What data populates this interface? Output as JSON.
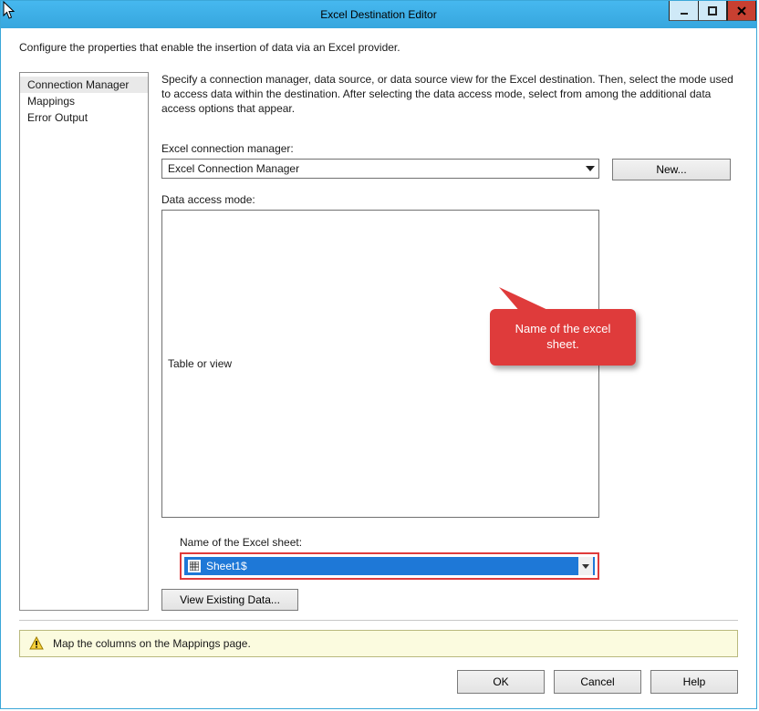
{
  "window": {
    "title": "Excel Destination Editor"
  },
  "intro": "Configure the properties that enable the insertion of data via an Excel provider.",
  "nav": {
    "items": [
      {
        "label": "Connection Manager",
        "selected": true
      },
      {
        "label": "Mappings",
        "selected": false
      },
      {
        "label": "Error Output",
        "selected": false
      }
    ]
  },
  "description": "Specify a connection manager, data source, or data source view for the Excel destination. Then, select the mode used to access data within the destination. After selecting the data access mode, select from among the additional data access options that appear.",
  "fields": {
    "conn_label": "Excel connection manager:",
    "conn_value": "Excel Connection Manager",
    "new_button": "New...",
    "mode_label": "Data access mode:",
    "mode_value": "Table or view",
    "sheet_label": "Name of the Excel sheet:",
    "sheet_value": "Sheet1$",
    "view_existing": "View Existing Data..."
  },
  "callout_text": "Name of the excel sheet.",
  "warning_text": "Map the columns on the Mappings page.",
  "buttons": {
    "ok": "OK",
    "cancel": "Cancel",
    "help": "Help"
  }
}
